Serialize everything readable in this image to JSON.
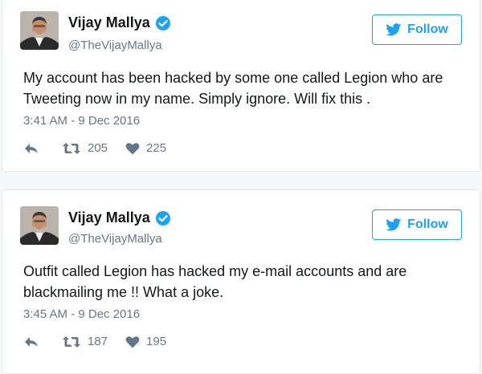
{
  "tweets": [
    {
      "display_name": "Vijay Mallya",
      "handle": "@TheVijayMallya",
      "follow_label": "Follow",
      "text": "My account has been hacked by some one called Legion who are Tweeting now in my name. Simply ignore. Will fix this .",
      "timestamp": "3:41 AM - 9 Dec 2016",
      "retweets": "205",
      "likes": "225",
      "verified": true
    },
    {
      "display_name": "Vijay Mallya",
      "handle": "@TheVijayMallya",
      "follow_label": "Follow",
      "text": "Outfit called Legion has hacked my e-mail accounts and are blackmailing me !! What a joke.",
      "timestamp": "3:45 AM - 9 Dec 2016",
      "retweets": "187",
      "likes": "195",
      "verified": true
    }
  ],
  "icons": {
    "verified": "verified-badge-icon",
    "follow": "twitter-bird-icon",
    "reply": "reply-icon",
    "retweet": "retweet-icon",
    "like": "heart-icon"
  },
  "colors": {
    "twitter_blue": "#1da1f2",
    "text_primary": "#14171a",
    "text_secondary": "#657786",
    "border": "#e1e8ed",
    "background": "#f5f8fa"
  }
}
